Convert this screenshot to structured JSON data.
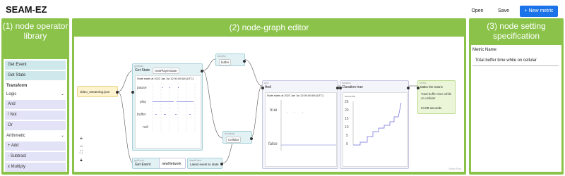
{
  "app": {
    "title": "SEAM-EZ"
  },
  "toolbar": {
    "open_label": "Open",
    "save_label": "Save",
    "new_metric_label": "+ New metric"
  },
  "panels": {
    "left": {
      "title": "(1) node operator library"
    },
    "middle": {
      "title": "(2) node-graph editor"
    },
    "right": {
      "title": "(3) node setting specification"
    }
  },
  "library": {
    "event_items": [
      "Get Event",
      "Get State"
    ],
    "transform_label": "Transform",
    "logic_label": "Logic",
    "logic_items": [
      "And",
      "! Not",
      "Or"
    ],
    "arithmetic_label": "Arithmetic",
    "arithmetic_items": [
      "+ Add",
      "- Subtract",
      "x Multiply"
    ]
  },
  "graph": {
    "video_node": "video_streaming.json",
    "get_state": {
      "cap": "getState",
      "label": "Get State",
      "value": "newPlayerState"
    },
    "state_chart": {
      "title": "State starts at 2022 Jan 1st 12:00:00 AM (UTC)",
      "rows": [
        "pause",
        "play",
        "buffer",
        "null"
      ]
    },
    "buffer_node": {
      "cap": "isBuffer",
      "value": "buffer"
    },
    "cellular_node": {
      "cap": "isCellular",
      "value": "Cellular"
    },
    "get_event": {
      "cap": "getEvent",
      "label": "Get Event",
      "value": "newNetwork"
    },
    "latest_node": {
      "cap": "latestEvent",
      "label": "Latest event to state"
    },
    "and_node": {
      "cap": "And",
      "label": "And",
      "chart_title": "State starts at 2022 Jan 1st 12:00:00 AM (UTC)",
      "rows": [
        "true",
        "false"
      ]
    },
    "duration_node": {
      "cap": "duration",
      "label": "Duration true",
      "unit": "seconds",
      "ticks": [
        "25",
        "20",
        "15",
        "10",
        "5",
        "0"
      ]
    },
    "metric_node": {
      "cap": "metric",
      "label": "Make the metric",
      "desc": "Total buffer time while on cellular",
      "value": "24.09 seconds"
    },
    "credit": "React Flow"
  },
  "spec": {
    "metric_name_label": "Metric Name",
    "metric_name_value": "Total buffer time while on cellular"
  }
}
